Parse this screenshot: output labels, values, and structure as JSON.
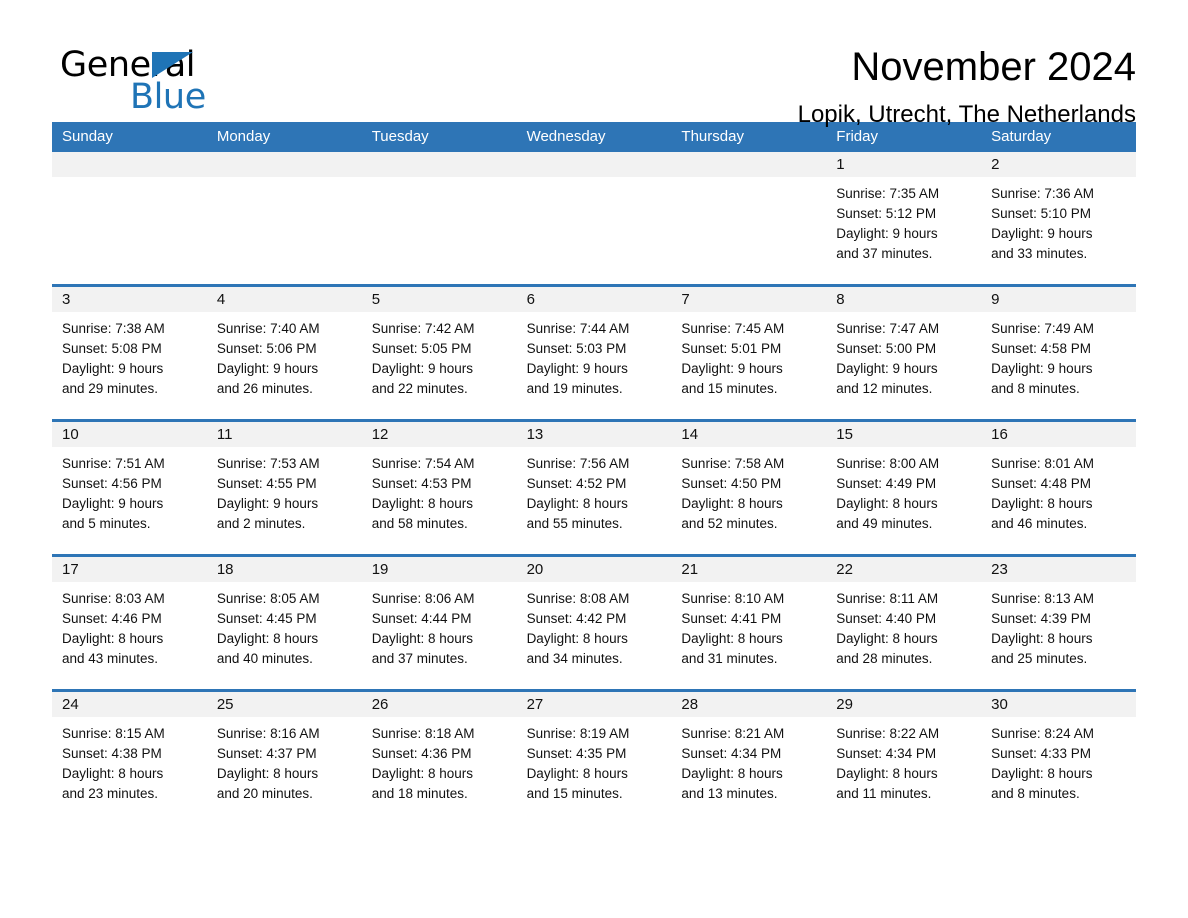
{
  "brand": {
    "word1": "General",
    "word2": "Blue",
    "triangle_color": "#1F74B6",
    "icon": "triangle-logo-icon"
  },
  "header": {
    "title": "November 2024",
    "subtitle": "Lopik, Utrecht, The Netherlands"
  },
  "theme": {
    "header_blue": "#2E75B6",
    "band_gray": "#F2F2F2",
    "text": "#111111"
  },
  "calendar": {
    "weekdays": [
      "Sunday",
      "Monday",
      "Tuesday",
      "Wednesday",
      "Thursday",
      "Friday",
      "Saturday"
    ],
    "weeks": [
      [
        {
          "day": "",
          "empty": true
        },
        {
          "day": "",
          "empty": true
        },
        {
          "day": "",
          "empty": true
        },
        {
          "day": "",
          "empty": true
        },
        {
          "day": "",
          "empty": true
        },
        {
          "day": "1",
          "sunrise": "Sunrise: 7:35 AM",
          "sunset": "Sunset: 5:12 PM",
          "daylight1": "Daylight: 9 hours",
          "daylight2": "and 37 minutes."
        },
        {
          "day": "2",
          "sunrise": "Sunrise: 7:36 AM",
          "sunset": "Sunset: 5:10 PM",
          "daylight1": "Daylight: 9 hours",
          "daylight2": "and 33 minutes."
        }
      ],
      [
        {
          "day": "3",
          "sunrise": "Sunrise: 7:38 AM",
          "sunset": "Sunset: 5:08 PM",
          "daylight1": "Daylight: 9 hours",
          "daylight2": "and 29 minutes."
        },
        {
          "day": "4",
          "sunrise": "Sunrise: 7:40 AM",
          "sunset": "Sunset: 5:06 PM",
          "daylight1": "Daylight: 9 hours",
          "daylight2": "and 26 minutes."
        },
        {
          "day": "5",
          "sunrise": "Sunrise: 7:42 AM",
          "sunset": "Sunset: 5:05 PM",
          "daylight1": "Daylight: 9 hours",
          "daylight2": "and 22 minutes."
        },
        {
          "day": "6",
          "sunrise": "Sunrise: 7:44 AM",
          "sunset": "Sunset: 5:03 PM",
          "daylight1": "Daylight: 9 hours",
          "daylight2": "and 19 minutes."
        },
        {
          "day": "7",
          "sunrise": "Sunrise: 7:45 AM",
          "sunset": "Sunset: 5:01 PM",
          "daylight1": "Daylight: 9 hours",
          "daylight2": "and 15 minutes."
        },
        {
          "day": "8",
          "sunrise": "Sunrise: 7:47 AM",
          "sunset": "Sunset: 5:00 PM",
          "daylight1": "Daylight: 9 hours",
          "daylight2": "and 12 minutes."
        },
        {
          "day": "9",
          "sunrise": "Sunrise: 7:49 AM",
          "sunset": "Sunset: 4:58 PM",
          "daylight1": "Daylight: 9 hours",
          "daylight2": "and 8 minutes."
        }
      ],
      [
        {
          "day": "10",
          "sunrise": "Sunrise: 7:51 AM",
          "sunset": "Sunset: 4:56 PM",
          "daylight1": "Daylight: 9 hours",
          "daylight2": "and 5 minutes."
        },
        {
          "day": "11",
          "sunrise": "Sunrise: 7:53 AM",
          "sunset": "Sunset: 4:55 PM",
          "daylight1": "Daylight: 9 hours",
          "daylight2": "and 2 minutes."
        },
        {
          "day": "12",
          "sunrise": "Sunrise: 7:54 AM",
          "sunset": "Sunset: 4:53 PM",
          "daylight1": "Daylight: 8 hours",
          "daylight2": "and 58 minutes."
        },
        {
          "day": "13",
          "sunrise": "Sunrise: 7:56 AM",
          "sunset": "Sunset: 4:52 PM",
          "daylight1": "Daylight: 8 hours",
          "daylight2": "and 55 minutes."
        },
        {
          "day": "14",
          "sunrise": "Sunrise: 7:58 AM",
          "sunset": "Sunset: 4:50 PM",
          "daylight1": "Daylight: 8 hours",
          "daylight2": "and 52 minutes."
        },
        {
          "day": "15",
          "sunrise": "Sunrise: 8:00 AM",
          "sunset": "Sunset: 4:49 PM",
          "daylight1": "Daylight: 8 hours",
          "daylight2": "and 49 minutes."
        },
        {
          "day": "16",
          "sunrise": "Sunrise: 8:01 AM",
          "sunset": "Sunset: 4:48 PM",
          "daylight1": "Daylight: 8 hours",
          "daylight2": "and 46 minutes."
        }
      ],
      [
        {
          "day": "17",
          "sunrise": "Sunrise: 8:03 AM",
          "sunset": "Sunset: 4:46 PM",
          "daylight1": "Daylight: 8 hours",
          "daylight2": "and 43 minutes."
        },
        {
          "day": "18",
          "sunrise": "Sunrise: 8:05 AM",
          "sunset": "Sunset: 4:45 PM",
          "daylight1": "Daylight: 8 hours",
          "daylight2": "and 40 minutes."
        },
        {
          "day": "19",
          "sunrise": "Sunrise: 8:06 AM",
          "sunset": "Sunset: 4:44 PM",
          "daylight1": "Daylight: 8 hours",
          "daylight2": "and 37 minutes."
        },
        {
          "day": "20",
          "sunrise": "Sunrise: 8:08 AM",
          "sunset": "Sunset: 4:42 PM",
          "daylight1": "Daylight: 8 hours",
          "daylight2": "and 34 minutes."
        },
        {
          "day": "21",
          "sunrise": "Sunrise: 8:10 AM",
          "sunset": "Sunset: 4:41 PM",
          "daylight1": "Daylight: 8 hours",
          "daylight2": "and 31 minutes."
        },
        {
          "day": "22",
          "sunrise": "Sunrise: 8:11 AM",
          "sunset": "Sunset: 4:40 PM",
          "daylight1": "Daylight: 8 hours",
          "daylight2": "and 28 minutes."
        },
        {
          "day": "23",
          "sunrise": "Sunrise: 8:13 AM",
          "sunset": "Sunset: 4:39 PM",
          "daylight1": "Daylight: 8 hours",
          "daylight2": "and 25 minutes."
        }
      ],
      [
        {
          "day": "24",
          "sunrise": "Sunrise: 8:15 AM",
          "sunset": "Sunset: 4:38 PM",
          "daylight1": "Daylight: 8 hours",
          "daylight2": "and 23 minutes."
        },
        {
          "day": "25",
          "sunrise": "Sunrise: 8:16 AM",
          "sunset": "Sunset: 4:37 PM",
          "daylight1": "Daylight: 8 hours",
          "daylight2": "and 20 minutes."
        },
        {
          "day": "26",
          "sunrise": "Sunrise: 8:18 AM",
          "sunset": "Sunset: 4:36 PM",
          "daylight1": "Daylight: 8 hours",
          "daylight2": "and 18 minutes."
        },
        {
          "day": "27",
          "sunrise": "Sunrise: 8:19 AM",
          "sunset": "Sunset: 4:35 PM",
          "daylight1": "Daylight: 8 hours",
          "daylight2": "and 15 minutes."
        },
        {
          "day": "28",
          "sunrise": "Sunrise: 8:21 AM",
          "sunset": "Sunset: 4:34 PM",
          "daylight1": "Daylight: 8 hours",
          "daylight2": "and 13 minutes."
        },
        {
          "day": "29",
          "sunrise": "Sunrise: 8:22 AM",
          "sunset": "Sunset: 4:34 PM",
          "daylight1": "Daylight: 8 hours",
          "daylight2": "and 11 minutes."
        },
        {
          "day": "30",
          "sunrise": "Sunrise: 8:24 AM",
          "sunset": "Sunset: 4:33 PM",
          "daylight1": "Daylight: 8 hours",
          "daylight2": "and 8 minutes."
        }
      ]
    ]
  }
}
